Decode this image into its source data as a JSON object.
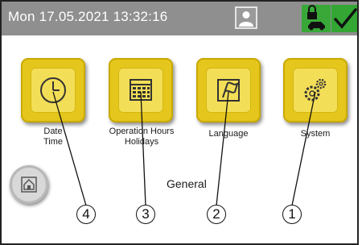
{
  "status_bar": {
    "datetime": "Mon 17.05.2021  13:32:16",
    "user_icon": "user-icon",
    "lock_icon": "lock-vehicle-icon",
    "confirm_icon": "checkmark-icon"
  },
  "menu": {
    "items": [
      {
        "label": "Date\nTime",
        "icon": "clock-icon"
      },
      {
        "label": "Operation Hours\nHolidays",
        "icon": "calendar-icon"
      },
      {
        "label": "Language",
        "icon": "language-icon"
      },
      {
        "label": "System",
        "icon": "gears-icon"
      }
    ]
  },
  "section_title": "General",
  "home_icon": "home-icon",
  "callouts": [
    "4",
    "3",
    "2",
    "1"
  ],
  "colors": {
    "status_bar": "#8f8f8f",
    "tile": "#e5c61d",
    "green": "#39a839"
  }
}
